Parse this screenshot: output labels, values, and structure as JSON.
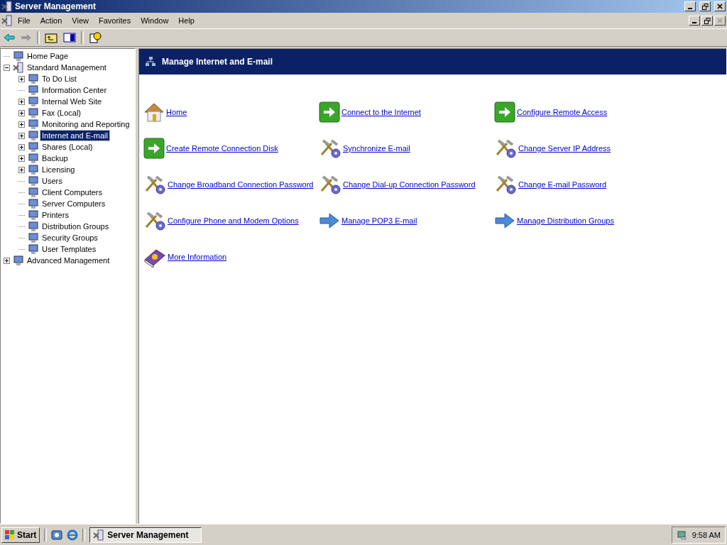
{
  "window": {
    "title": "Server Management"
  },
  "menu": [
    "File",
    "Action",
    "View",
    "Favorites",
    "Window",
    "Help"
  ],
  "tree": [
    {
      "label": "Home Page",
      "selected": false
    },
    {
      "label": "Standard Management",
      "selected": false,
      "expanded": true,
      "children": [
        {
          "label": "To Do List",
          "selected": false,
          "expanded": false
        },
        {
          "label": "Information Center",
          "selected": false
        },
        {
          "label": "Internal Web Site",
          "selected": false,
          "expanded": false
        },
        {
          "label": "Fax (Local)",
          "selected": false,
          "expanded": false
        },
        {
          "label": "Monitoring and Reporting",
          "selected": false,
          "expanded": false
        },
        {
          "label": "Internet and E-mail",
          "selected": true,
          "expanded": false
        },
        {
          "label": "Shares (Local)",
          "selected": false,
          "expanded": false
        },
        {
          "label": "Backup",
          "selected": false,
          "expanded": false
        },
        {
          "label": "Licensing",
          "selected": false,
          "expanded": false
        },
        {
          "label": "Users",
          "selected": false
        },
        {
          "label": "Client Computers",
          "selected": false
        },
        {
          "label": "Server Computers",
          "selected": false
        },
        {
          "label": "Printers",
          "selected": false
        },
        {
          "label": "Distribution Groups",
          "selected": false
        },
        {
          "label": "Security Groups",
          "selected": false
        },
        {
          "label": "User Templates",
          "selected": false
        }
      ]
    },
    {
      "label": "Advanced Management",
      "selected": false,
      "expanded": false
    }
  ],
  "panel": {
    "title": "Manage Internet and E-mail",
    "links": [
      {
        "label": "Home",
        "kind": "home"
      },
      {
        "label": "Connect to the Internet",
        "kind": "go"
      },
      {
        "label": "Configure Remote Access",
        "kind": "go"
      },
      {
        "label": "Create Remote Connection Disk",
        "kind": "go"
      },
      {
        "label": "Synchronize E-mail",
        "kind": "tools"
      },
      {
        "label": "Change Server IP Address",
        "kind": "tools"
      },
      {
        "label": "Change Broadband Connection Password",
        "kind": "tools"
      },
      {
        "label": "Change Dial-up Connection Password",
        "kind": "tools"
      },
      {
        "label": "Change E-mail Password",
        "kind": "tools"
      },
      {
        "label": "Configure Phone and Modem Options",
        "kind": "tools"
      },
      {
        "label": "Manage POP3 E-mail",
        "kind": "arrow"
      },
      {
        "label": "Manage Distribution Groups",
        "kind": "arrow"
      },
      {
        "label": "More Information",
        "kind": "book"
      }
    ]
  },
  "taskbar": {
    "start": "Start",
    "tasks": [
      {
        "label": "Server Management",
        "selected": true
      }
    ],
    "clock": "9:58 AM"
  }
}
